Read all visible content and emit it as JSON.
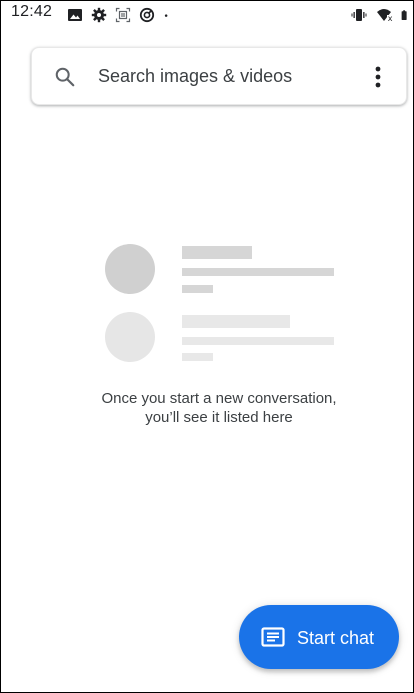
{
  "status_bar": {
    "time": "12:42",
    "left_icons": [
      "image-icon",
      "gear-icon",
      "screenshot-icon",
      "data-saver-icon",
      "dot-icon"
    ],
    "right_icons": [
      "vibrate-icon",
      "wifi-icon",
      "battery-icon"
    ]
  },
  "search": {
    "placeholder": "Search images & videos",
    "search_icon": "search-icon",
    "menu_icon": "more-vertical-icon"
  },
  "empty_state": {
    "line1": "Once you start a new conversation,",
    "line2": "you’ll see it listed here"
  },
  "fab": {
    "label": "Start chat",
    "icon": "message-icon",
    "color": "#1a73e8"
  },
  "colors": {
    "placeholder_dark": "#d0d0d0",
    "placeholder_light": "#e6e6e6"
  }
}
